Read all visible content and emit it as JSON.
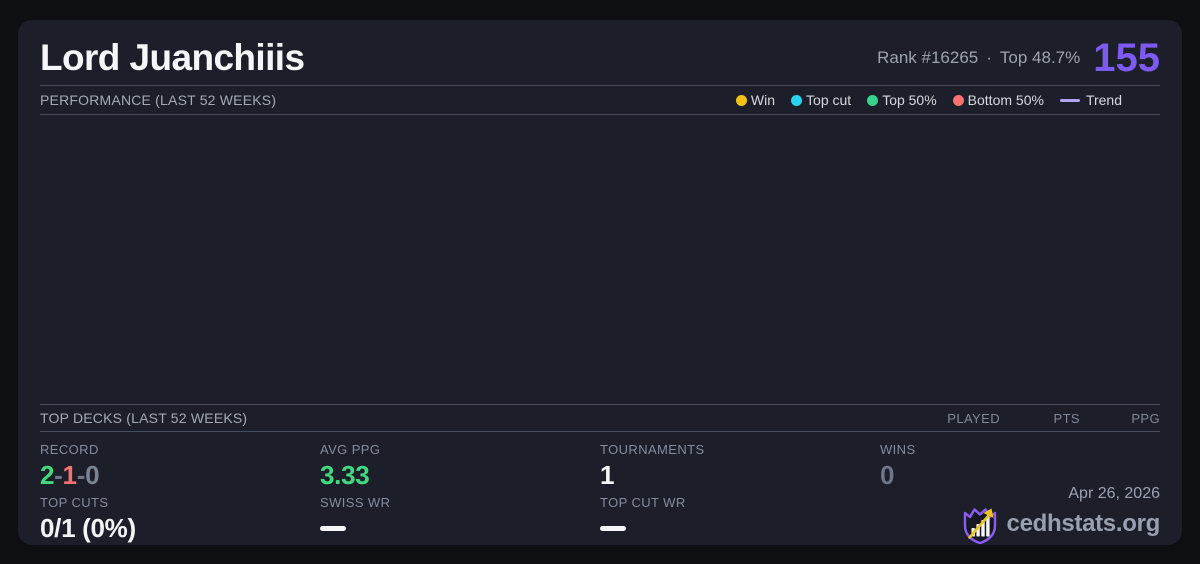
{
  "header": {
    "player_name": "Lord Juanchiiis",
    "rank_text": "Rank #16265",
    "separator": "·",
    "top_percent_text": "Top 48.7%",
    "score": "155"
  },
  "performance": {
    "title": "PERFORMANCE (LAST 52 WEEKS)",
    "legend": [
      {
        "label": "Win",
        "icon": "win-dot-icon",
        "color": "#f2c218"
      },
      {
        "label": "Top cut",
        "icon": "top-cut-dot-icon",
        "color": "#27d3ee"
      },
      {
        "label": "Top 50%",
        "icon": "top-50-dot-icon",
        "color": "#37d38e"
      },
      {
        "label": "Bottom 50%",
        "icon": "bottom-50-dot-icon",
        "color": "#f87171"
      },
      {
        "label": "Trend",
        "icon": "trend-line-icon",
        "color": "#b2a3f3"
      }
    ]
  },
  "top_decks": {
    "title": "TOP DECKS (LAST 52 WEEKS)",
    "columns": [
      "PLAYED",
      "PTS",
      "PPG"
    ]
  },
  "stats": {
    "record": {
      "label": "RECORD",
      "wins": "2",
      "losses": "1",
      "draws": "0",
      "separator": "-"
    },
    "avg_ppg": {
      "label": "AVG PPG",
      "value": "3.33"
    },
    "tournaments": {
      "label": "TOURNAMENTS",
      "value": "1"
    },
    "wins": {
      "label": "WINS",
      "value": "0"
    },
    "top_cuts": {
      "label": "TOP CUTS",
      "value": "0/1 (0%)"
    },
    "swiss_wr": {
      "label": "SWISS WR",
      "value": "—"
    },
    "top_cut_wr": {
      "label": "TOP CUT WR",
      "value": "—"
    }
  },
  "footer": {
    "date": "Apr 26, 2026",
    "brand": "cedhstats.org"
  },
  "colors": {
    "page_bg": "#0e0f13",
    "card_bg": "#1c1f29",
    "divider": "#454c5b",
    "accent_purple": "#7d5af1",
    "positive_green": "#41d97e",
    "negative_red": "#f87171",
    "muted_gray": "#6e7687",
    "win_yellow": "#f2c218",
    "top_cut_cyan": "#27d3ee",
    "top50_green": "#37d38e",
    "bottom50_red": "#f87171",
    "trend_lavender": "#b2a3f3",
    "logo_purple": "#8b5cf6",
    "logo_gold": "#f0c419"
  }
}
